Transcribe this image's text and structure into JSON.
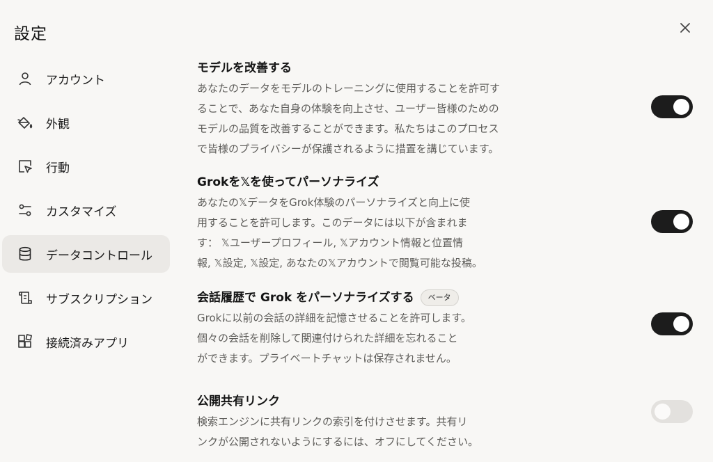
{
  "window": {
    "title": "設定"
  },
  "sidebar": {
    "items": [
      {
        "label": "アカウント",
        "icon": "user-icon",
        "active": false
      },
      {
        "label": "外観",
        "icon": "paint-bucket-icon",
        "active": false
      },
      {
        "label": "行動",
        "icon": "cursor-box-icon",
        "active": false
      },
      {
        "label": "カスタマイズ",
        "icon": "sliders-icon",
        "active": false
      },
      {
        "label": "データコントロール",
        "icon": "database-icon",
        "active": true
      },
      {
        "label": "サブスクリプション",
        "icon": "scroll-icon",
        "active": false
      },
      {
        "label": "接続済みアプリ",
        "icon": "apps-grid-icon",
        "active": false
      }
    ]
  },
  "settings": [
    {
      "title": "モデルを改善する",
      "lines": [
        "あなたのデータをモデルのトレーニングに使用することを許可す",
        "ることで、あなた自身の体験を向上させ、ユーザー皆様のための",
        "モデルの品質を改善することができます。私たちはこのプロセス",
        "で皆様のプライバシーが保護されるように措置を講じています。"
      ],
      "enabled": true
    },
    {
      "title": "Grokを𝕏を使ってパーソナライズ",
      "lines": [
        "あなたの𝕏データをGrok体験のパーソナライズと向上に使",
        "用することを許可します。このデータには以下が含まれま",
        "す： 𝕏ユーザープロフィール, 𝕏アカウント情報と位置情",
        "報, 𝕏設定, 𝕏設定, あなたの𝕏アカウントで閲覧可能な投稿。"
      ],
      "enabled": true
    },
    {
      "title": "会話履歴で Grok をパーソナライズする",
      "badge": "ベータ",
      "lines": [
        "Grokに以前の会話の詳細を記憶させることを許可します。",
        "個々の会話を削除して関連付けられた詳細を忘れること",
        "ができます。プライベートチャットは保存されません。"
      ],
      "enabled": true
    },
    {
      "title": "公開共有リンク",
      "lines": [
        "検索エンジンに共有リンクの索引を付けさせます。共有リ",
        "ンクが公開されないようにするには、オフにしてください。"
      ],
      "enabled": false
    }
  ],
  "colors": {
    "toggle_on": "#1c1c1c",
    "toggle_off": "#e3e1de",
    "active_nav_bg": "#ebe9e6"
  }
}
